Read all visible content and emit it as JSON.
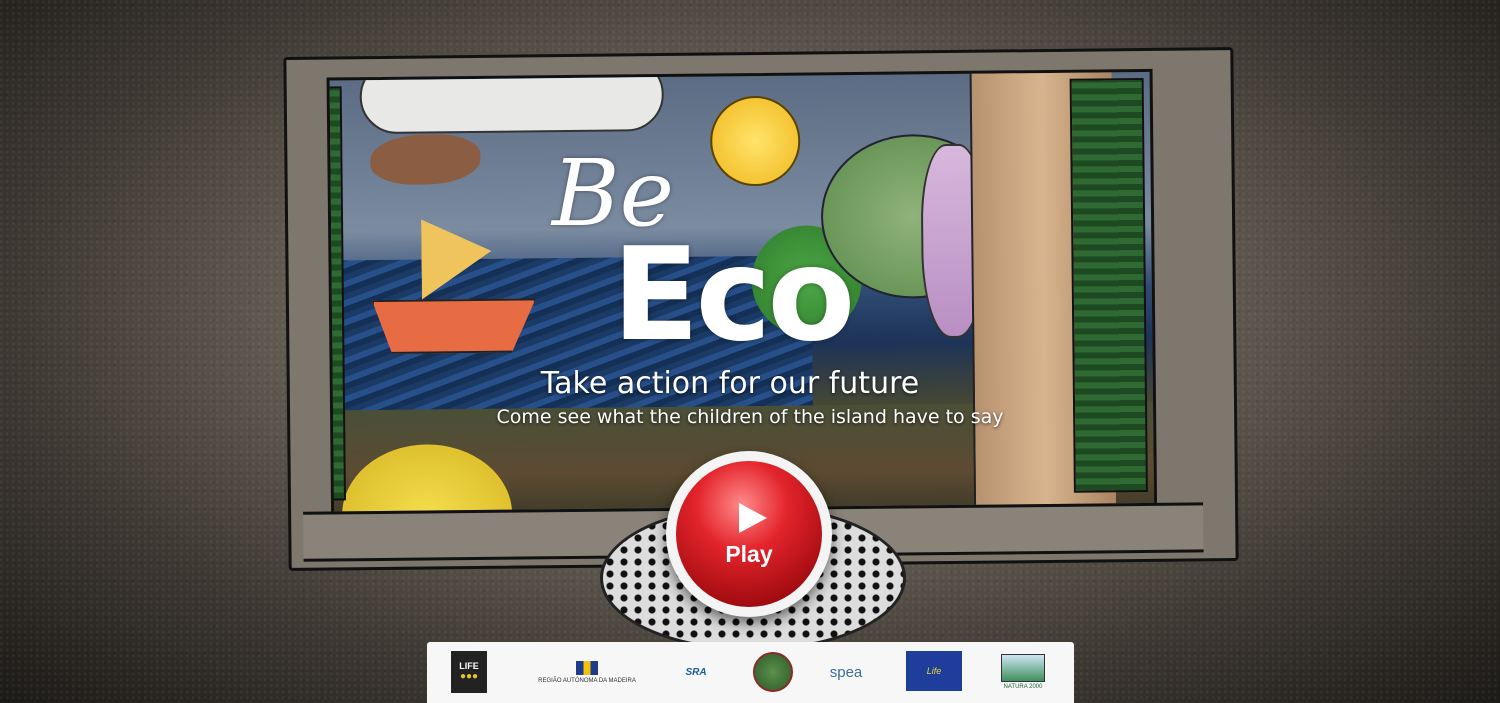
{
  "hero": {
    "title_be": "Be",
    "title_eco": "Eco",
    "tagline": "Take action for our future",
    "subtagline": "Come see what the children of the island have to say"
  },
  "play_button": {
    "label": "Play",
    "icon": "play-icon",
    "accent_color": "#e3242b"
  },
  "sponsors": {
    "items": [
      {
        "name": "life-eco-logo",
        "text": "LIFE"
      },
      {
        "name": "madeira-government-logo",
        "text": "REGIÃO AUTÓNOMA DA MADEIRA"
      },
      {
        "name": "sra-logo",
        "text": "SRA"
      },
      {
        "name": "natural-park-logo",
        "text": ""
      },
      {
        "name": "spea-logo",
        "text": "spea"
      },
      {
        "name": "eu-life-logo",
        "text": "Life"
      },
      {
        "name": "natura-2000-logo",
        "text": "NATURA 2000"
      }
    ]
  }
}
